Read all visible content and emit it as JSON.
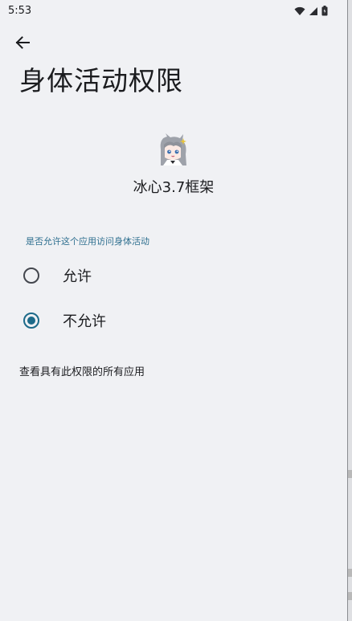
{
  "status_bar": {
    "time": "5:53"
  },
  "header": {
    "title": "身体活动权限"
  },
  "app": {
    "name": "冰心3.7框架"
  },
  "permission": {
    "question": "是否允许这个应用访问身体活动",
    "options": [
      {
        "label": "允许",
        "selected": false
      },
      {
        "label": "不允许",
        "selected": true
      }
    ]
  },
  "footer": {
    "view_all_label": "查看具有此权限的所有应用"
  },
  "colors": {
    "accent": "#1d6a89",
    "background": "#f0f1f4",
    "question_text": "#2e6f8f"
  }
}
